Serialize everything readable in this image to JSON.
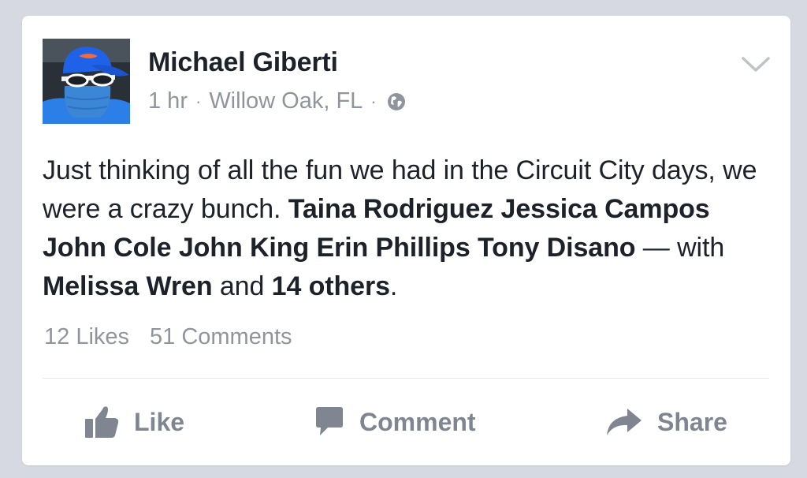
{
  "post": {
    "author": "Michael Giberti",
    "time": "1 hr",
    "separator": "·",
    "location": "Willow Oak, FL",
    "privacy_icon": "globe-icon",
    "menu_icon": "chevron-down-icon",
    "text_intro": "Just thinking of all the fun we had in the Circuit City days, we were a crazy bunch.",
    "tagged": [
      "Taina Rodriguez",
      "Jessica Campos",
      "John Cole",
      "John King",
      "Erin Phillips",
      "Tony Disano"
    ],
    "dash": "—",
    "with_label": "with",
    "with_person": "Melissa Wren",
    "and_label": "and",
    "others": "14 others",
    "period": "."
  },
  "stats": {
    "likes": "12 Likes",
    "comments": "51 Comments"
  },
  "actions": {
    "like": "Like",
    "comment": "Comment",
    "share": "Share"
  },
  "colors": {
    "background": "#d6d9e1",
    "card": "#ffffff",
    "text": "#1d2129",
    "muted": "#90949c",
    "action": "#7f8591",
    "cap_blue": "#1f62e8",
    "shirt_blue": "#2c7fe6"
  }
}
